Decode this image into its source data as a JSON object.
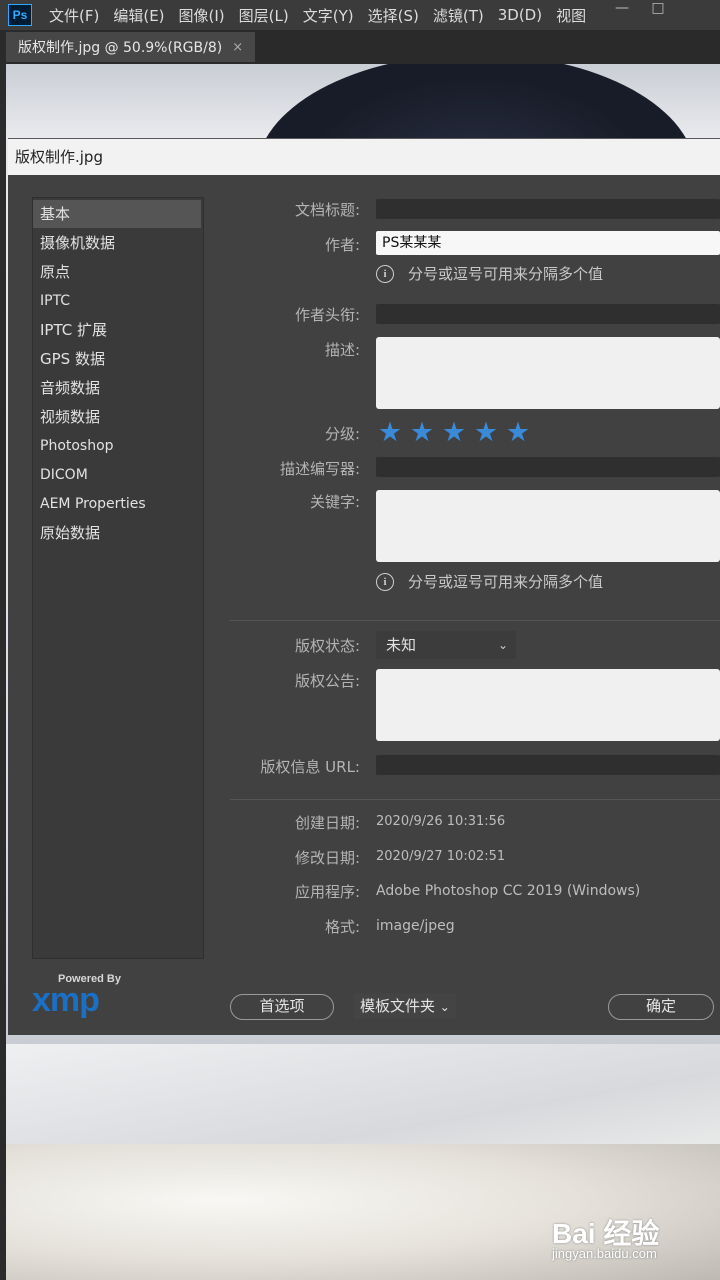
{
  "app": {
    "logo": "Ps",
    "menu": [
      "文件(F)",
      "编辑(E)",
      "图像(I)",
      "图层(L)",
      "文字(Y)",
      "选择(S)",
      "滤镜(T)",
      "3D(D)",
      "视图"
    ],
    "window_controls": [
      "—",
      "□"
    ]
  },
  "document_tab": {
    "label": "版权制作.jpg @ 50.9%(RGB/8)",
    "close": "×"
  },
  "dialog": {
    "title": "版权制作.jpg",
    "sidebar": [
      "基本",
      "摄像机数据",
      "原点",
      "IPTC",
      "IPTC 扩展",
      "GPS 数据",
      "音频数据",
      "视频数据",
      "Photoshop",
      "DICOM",
      "AEM Properties",
      "原始数据"
    ],
    "active_sidebar": "基本",
    "fields": {
      "doc_title_label": "文档标题:",
      "author_label": "作者:",
      "author_value": "PS某某某",
      "hint": "分号或逗号可用来分隔多个值",
      "author_title_label": "作者头衔:",
      "description_label": "描述:",
      "rating_label": "分级:",
      "rating": 5,
      "desc_writer_label": "描述编写器:",
      "keywords_label": "关键字:",
      "copyright_status_label": "版权状态:",
      "copyright_status_value": "未知",
      "copyright_notice_label": "版权公告:",
      "copyright_url_label": "版权信息 URL:",
      "created_label": "创建日期:",
      "created_value": "2020/9/26 10:31:56",
      "modified_label": "修改日期:",
      "modified_value": "2020/9/27 10:02:51",
      "app_label": "应用程序:",
      "app_value": "Adobe Photoshop CC 2019 (Windows)",
      "format_label": "格式:",
      "format_value": "image/jpeg"
    },
    "xmp": {
      "powered_by": "Powered By",
      "logo": "xmp"
    },
    "buttons": {
      "preferences": "首选项",
      "template_folder": "模板文件夹",
      "ok": "确定"
    }
  },
  "watermark": {
    "brand": "Bai 经验",
    "url": "jingyan.baidu.com"
  },
  "colors": {
    "accent_star": "#3a8ad8",
    "dialog_bg": "#414141",
    "xmp_blue": "#1b6fc5"
  }
}
